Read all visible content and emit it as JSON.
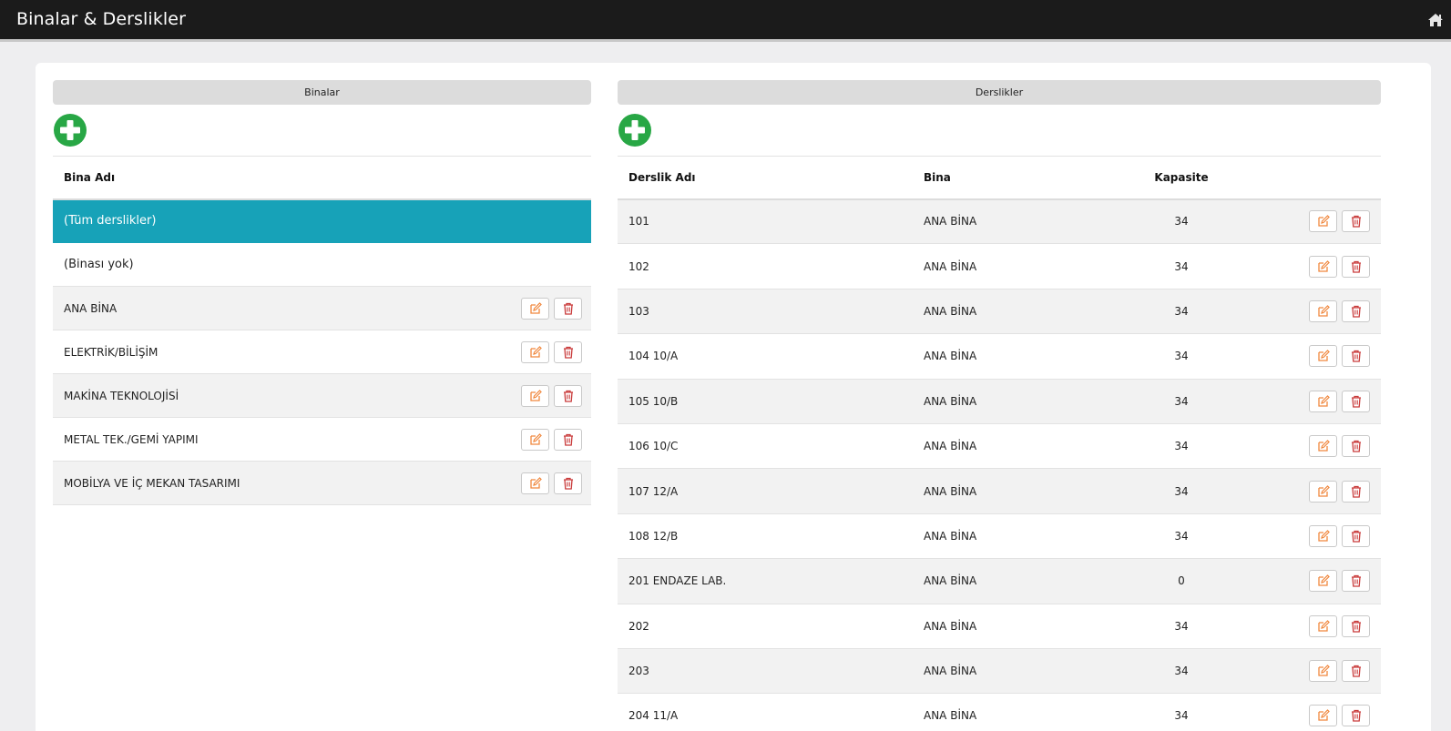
{
  "app": {
    "title": "Binalar & Derslikler",
    "home_icon": "home-icon"
  },
  "colors": {
    "topbar": "#1b1b1b",
    "selected": "#17a2b8",
    "add": "#28a745",
    "edit": "#f0883e",
    "delete": "#c93a3a"
  },
  "binalar": {
    "header": "Binalar",
    "column": "Bina Adı",
    "rows": [
      {
        "name": "(Tüm derslikler)",
        "selected": true,
        "actions": false
      },
      {
        "name": "(Binası yok)",
        "selected": false,
        "actions": false
      },
      {
        "name": "ANA BİNA",
        "selected": false,
        "actions": true
      },
      {
        "name": "ELEKTRİK/BİLİŞİM",
        "selected": false,
        "actions": true
      },
      {
        "name": "MAKİNA TEKNOLOJİSİ",
        "selected": false,
        "actions": true
      },
      {
        "name": "METAL TEK./GEMİ YAPIMI",
        "selected": false,
        "actions": true
      },
      {
        "name": "MOBİLYA VE İÇ MEKAN TASARIMI",
        "selected": false,
        "actions": true
      }
    ]
  },
  "derslikler": {
    "header": "Derslikler",
    "columns": {
      "name": "Derslik Adı",
      "bina": "Bina",
      "kapasite": "Kapasite"
    },
    "rows": [
      {
        "name": "101",
        "bina": "ANA BİNA",
        "kapasite": "34"
      },
      {
        "name": "102",
        "bina": "ANA BİNA",
        "kapasite": "34"
      },
      {
        "name": "103",
        "bina": "ANA BİNA",
        "kapasite": "34"
      },
      {
        "name": "104 10/A",
        "bina": "ANA BİNA",
        "kapasite": "34"
      },
      {
        "name": "105 10/B",
        "bina": "ANA BİNA",
        "kapasite": "34"
      },
      {
        "name": "106 10/C",
        "bina": "ANA BİNA",
        "kapasite": "34"
      },
      {
        "name": "107 12/A",
        "bina": "ANA BİNA",
        "kapasite": "34"
      },
      {
        "name": "108 12/B",
        "bina": "ANA BİNA",
        "kapasite": "34"
      },
      {
        "name": "201 ENDAZE LAB.",
        "bina": "ANA BİNA",
        "kapasite": "0"
      },
      {
        "name": "202",
        "bina": "ANA BİNA",
        "kapasite": "34"
      },
      {
        "name": "203",
        "bina": "ANA BİNA",
        "kapasite": "34"
      },
      {
        "name": "204 11/A",
        "bina": "ANA BİNA",
        "kapasite": "34"
      }
    ]
  }
}
